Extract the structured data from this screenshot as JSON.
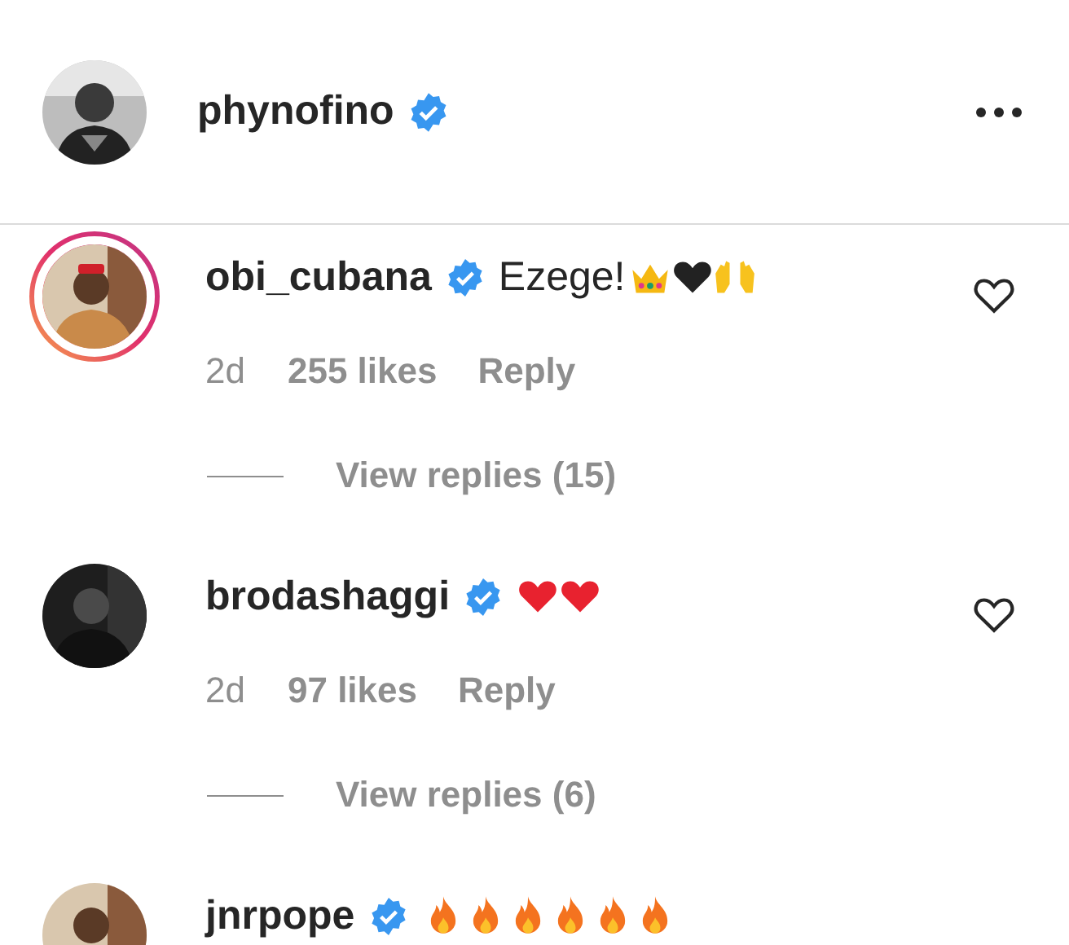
{
  "post_author": {
    "username": "phynofino",
    "verified": true
  },
  "comments": [
    {
      "username": "obi_cubana",
      "verified": true,
      "story_ring": true,
      "text": "Ezege!",
      "emojis": [
        {
          "kind": "crown"
        },
        {
          "kind": "heart",
          "color": "#222222"
        },
        {
          "kind": "hands"
        }
      ],
      "time": "2d",
      "likes": "255 likes",
      "reply": "Reply",
      "view_replies": "View replies (15)",
      "liked": false
    },
    {
      "username": "brodashaggi",
      "verified": true,
      "story_ring": false,
      "emojis": [
        {
          "kind": "heart",
          "color": "#e8222f"
        },
        {
          "kind": "heart",
          "color": "#e8222f"
        }
      ],
      "time": "2d",
      "likes": "97 likes",
      "reply": "Reply",
      "view_replies": "View replies (6)",
      "liked": false
    },
    {
      "username": "jnrpope",
      "verified": true,
      "story_ring": false,
      "emojis": [
        {
          "kind": "fire"
        },
        {
          "kind": "fire"
        },
        {
          "kind": "fire"
        },
        {
          "kind": "fire"
        },
        {
          "kind": "fire"
        },
        {
          "kind": "fire"
        }
      ]
    }
  ]
}
